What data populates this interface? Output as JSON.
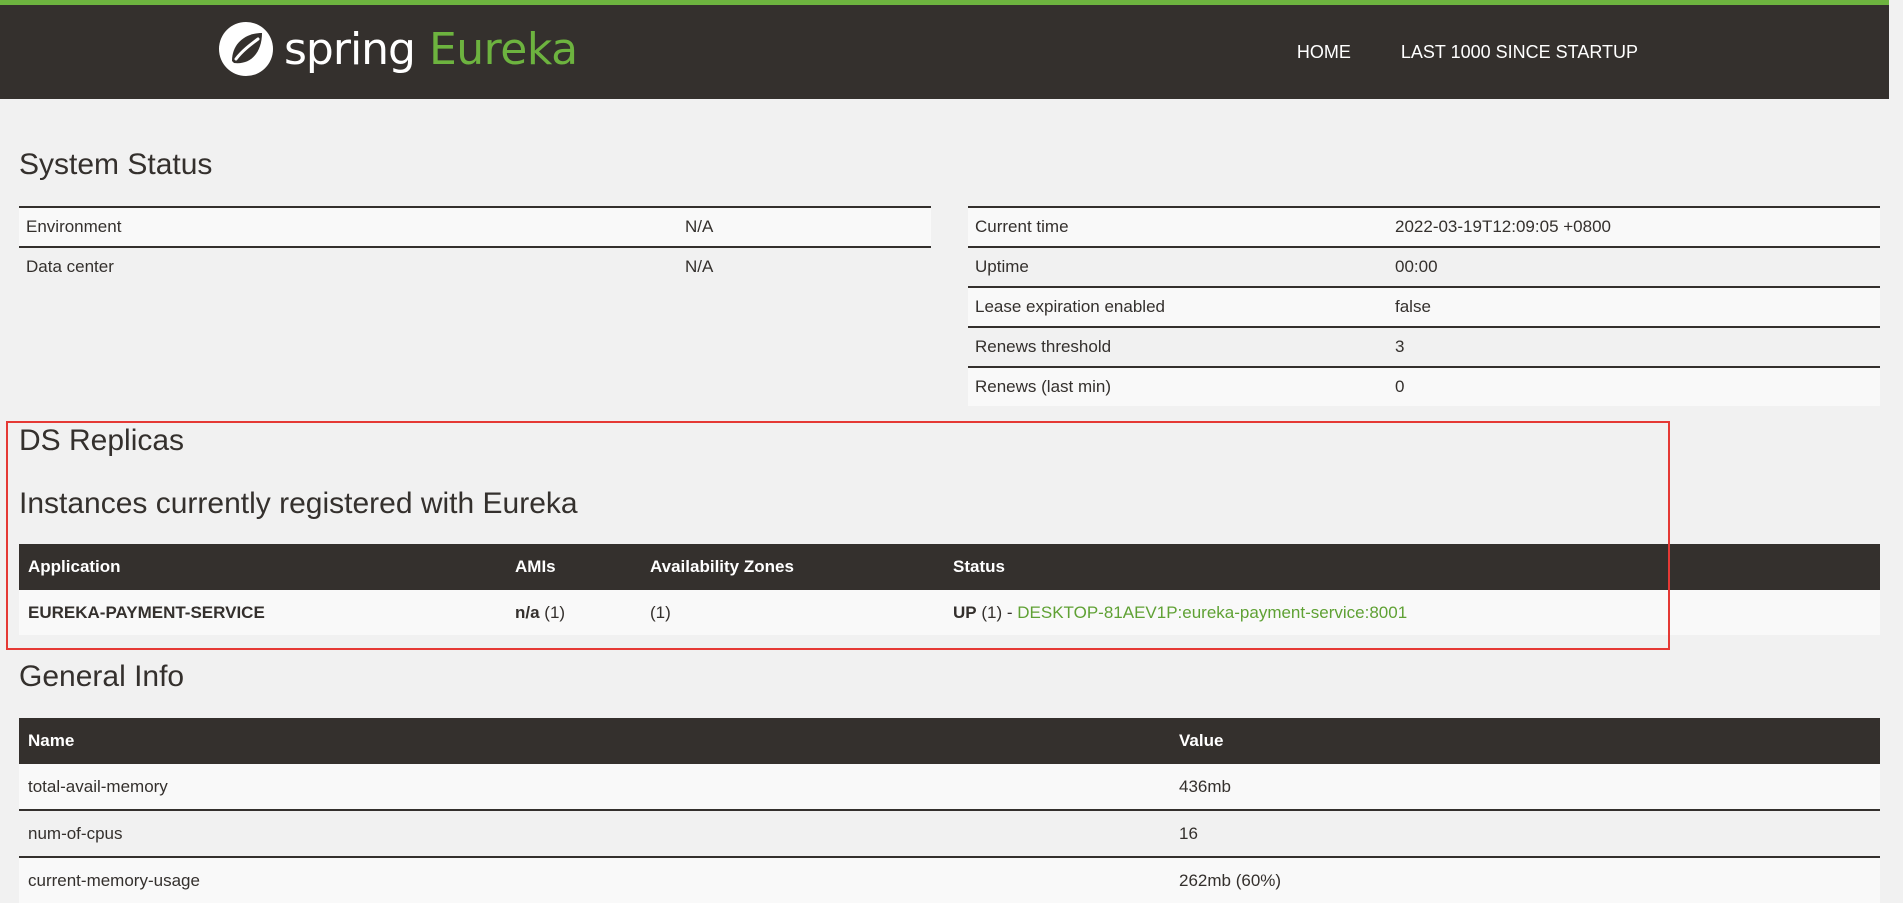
{
  "brand": {
    "spring": "spring",
    "eureka": "Eureka"
  },
  "nav": {
    "home": "HOME",
    "last1000": "LAST 1000 SINCE STARTUP"
  },
  "system_status": {
    "title": "System Status",
    "left": [
      {
        "label": "Environment",
        "value": "N/A"
      },
      {
        "label": "Data center",
        "value": "N/A"
      }
    ],
    "right": [
      {
        "label": "Current time",
        "value": "2022-03-19T12:09:05 +0800"
      },
      {
        "label": "Uptime",
        "value": "00:00"
      },
      {
        "label": "Lease expiration enabled",
        "value": "false"
      },
      {
        "label": "Renews threshold",
        "value": "3"
      },
      {
        "label": "Renews (last min)",
        "value": "0"
      }
    ]
  },
  "ds_replicas": {
    "title": "DS Replicas"
  },
  "instances": {
    "title": "Instances currently registered with Eureka",
    "headers": {
      "application": "Application",
      "amis": "AMIs",
      "zones": "Availability Zones",
      "status": "Status"
    },
    "rows": [
      {
        "application": "EUREKA-PAYMENT-SERVICE",
        "amis_bold": "n/a",
        "amis_count": " (1)",
        "zones": "(1)",
        "status_bold": "UP",
        "status_rest": " (1) - ",
        "instance_link": "DESKTOP-81AEV1P:eureka-payment-service:8001"
      }
    ]
  },
  "general_info": {
    "title": "General Info",
    "headers": {
      "name": "Name",
      "value": "Value"
    },
    "rows": [
      {
        "name": "total-avail-memory",
        "value": "436mb"
      },
      {
        "name": "num-of-cpus",
        "value": "16"
      },
      {
        "name": "current-memory-usage",
        "value": "262mb (60%)"
      }
    ]
  },
  "colors": {
    "accent": "#6db33f",
    "dark": "#34302d",
    "highlight": "#e53935"
  },
  "icons": {
    "logo": "spring-leaf-icon"
  }
}
